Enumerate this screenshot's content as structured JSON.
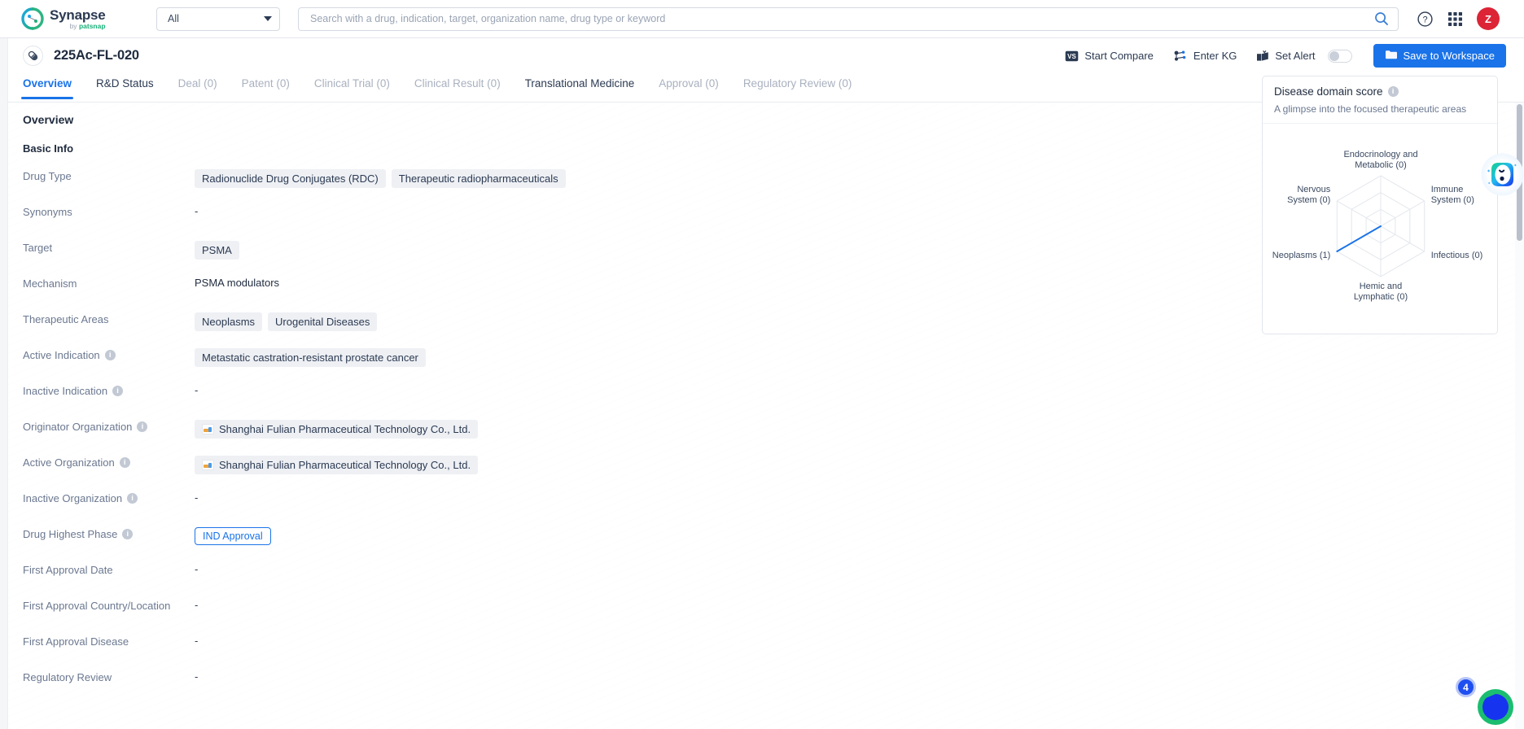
{
  "brand": {
    "name": "Synapse",
    "tagline_prefix": "by",
    "tagline_brand": "patsnap",
    "logo_icon": "synapse-logo-icon"
  },
  "topbar": {
    "scope_selected": "All",
    "scope_icon": "chevron-down-icon",
    "search": {
      "placeholder": "Search with a drug, indication, target, organization name, drug type or keyword",
      "value": "",
      "icon": "search-icon"
    },
    "help_icon": "help-circle-icon",
    "apps_icon": "grid-apps-icon",
    "avatar_initial": "Z",
    "avatar_color": "#dc2436"
  },
  "page_head": {
    "drug_icon": "capsule-pill-icon",
    "title": "225Ac-FL-020",
    "actions": [
      {
        "label": "Start Compare",
        "icon": "vs-compare-icon"
      },
      {
        "label": "Enter KG",
        "icon": "knowledge-graph-icon"
      },
      {
        "label": "Set Alert",
        "icon": "alert-bell-box-icon",
        "toggle": false
      }
    ],
    "save_button": {
      "label": "Save to Workspace",
      "icon": "folder-icon",
      "color": "#1a73e8"
    }
  },
  "tabs": [
    {
      "label": "Overview",
      "state": "active"
    },
    {
      "label": "R&D Status",
      "state": "enabled"
    },
    {
      "label": "Deal (0)",
      "state": "disabled"
    },
    {
      "label": "Patent (0)",
      "state": "disabled"
    },
    {
      "label": "Clinical Trial (0)",
      "state": "disabled"
    },
    {
      "label": "Clinical Result (0)",
      "state": "disabled"
    },
    {
      "label": "Translational Medicine",
      "state": "enabled"
    },
    {
      "label": "Approval (0)",
      "state": "disabled"
    },
    {
      "label": "Regulatory Review (0)",
      "state": "disabled"
    }
  ],
  "overview": {
    "section_title": "Overview",
    "basic_info_title": "Basic Info",
    "rows": [
      {
        "label": "Drug Type",
        "has_info": false,
        "type": "tags",
        "tags": [
          "Radionuclide Drug Conjugates (RDC)",
          "Therapeutic radiopharmaceuticals"
        ]
      },
      {
        "label": "Synonyms",
        "has_info": false,
        "type": "dash",
        "value": "-"
      },
      {
        "label": "Target",
        "has_info": false,
        "type": "tags",
        "tags": [
          "PSMA"
        ]
      },
      {
        "label": "Mechanism",
        "has_info": false,
        "type": "text",
        "value": "PSMA modulators"
      },
      {
        "label": "Therapeutic Areas",
        "has_info": false,
        "type": "tags",
        "tags": [
          "Neoplasms",
          "Urogenital Diseases"
        ]
      },
      {
        "label": "Active Indication",
        "has_info": true,
        "type": "tags",
        "tags": [
          "Metastatic castration-resistant prostate cancer"
        ]
      },
      {
        "label": "Inactive Indication",
        "has_info": true,
        "type": "dash",
        "value": "-"
      },
      {
        "label": "Originator Organization",
        "has_info": true,
        "type": "org-tags",
        "tags": [
          "Shanghai Fulian Pharmaceutical Technology Co., Ltd."
        ]
      },
      {
        "label": "Active Organization",
        "has_info": true,
        "type": "org-tags",
        "tags": [
          "Shanghai Fulian Pharmaceutical Technology Co., Ltd."
        ]
      },
      {
        "label": "Inactive Organization",
        "has_info": true,
        "type": "dash",
        "value": "-"
      },
      {
        "label": "Drug Highest Phase",
        "has_info": true,
        "type": "pill",
        "value": "IND Approval"
      },
      {
        "label": "First Approval Date",
        "has_info": false,
        "type": "dash",
        "value": "-"
      },
      {
        "label": "First Approval Country/Location",
        "has_info": false,
        "type": "dash",
        "value": "-"
      },
      {
        "label": "First Approval Disease",
        "has_info": false,
        "type": "dash",
        "value": "-"
      },
      {
        "label": "Regulatory Review",
        "has_info": false,
        "type": "dash",
        "value": "-"
      }
    ]
  },
  "disease_domain_card": {
    "title": "Disease domain score",
    "info_icon": "info-circle-icon",
    "subtitle": "A glimpse into the focused therapeutic areas"
  },
  "chart_data": {
    "type": "radar",
    "title": "Disease domain score",
    "subtitle": "A glimpse into the focused therapeutic areas",
    "categories": [
      "Endocrinology and Metabolic (0)",
      "Immune System (0)",
      "Infectious (0)",
      "Hemic and Lymphatic (0)",
      "Neoplasms (1)",
      "Nervous System (0)"
    ],
    "axis_short_labels": [
      "Endocrinology and Metabolic",
      "Immune System",
      "Infectious",
      "Hemic and Lymphatic",
      "Neoplasms",
      "Nervous System"
    ],
    "values": [
      0,
      0,
      0,
      0,
      1,
      0
    ],
    "rlim": [
      0,
      1
    ],
    "rings": 3,
    "grid": true,
    "legend": "none",
    "series_color": "#1a73e8",
    "grid_color": "#e6e9ee"
  },
  "mascot": {
    "name": "ai-assistant-mascot"
  },
  "floating": {
    "badge_count": "4",
    "icon": "chat-bubble-icon"
  },
  "scrollbar": {
    "name": "vertical-scrollbar"
  }
}
